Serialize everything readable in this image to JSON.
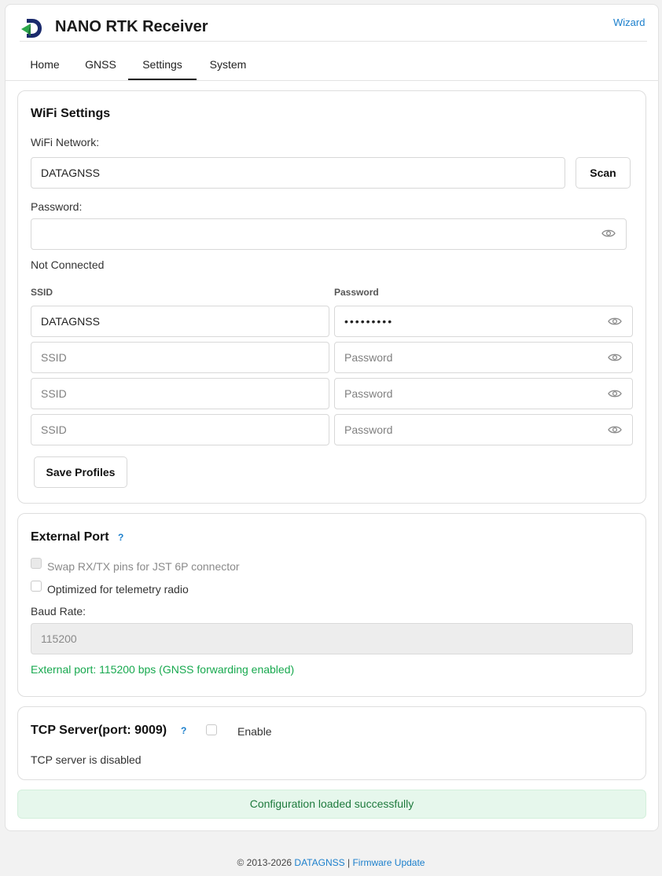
{
  "header": {
    "title": "NANO RTK Receiver",
    "wizard_link": "Wizard",
    "brand_colors": {
      "logo_dark": "#1a2a6c",
      "logo_green": "#2ba84a",
      "link": "#1b7fcc"
    }
  },
  "tabs": [
    {
      "label": "Home"
    },
    {
      "label": "GNSS"
    },
    {
      "label": "Settings",
      "active": true
    },
    {
      "label": "System"
    }
  ],
  "wifi": {
    "title": "WiFi Settings",
    "network_label": "WiFi Network:",
    "network_value": "DATAGNSS",
    "scan_label": "Scan",
    "password_label": "Password:",
    "password_value": "",
    "connection_status": "Not Connected",
    "ssid_header": "SSID",
    "password_header": "Password",
    "profiles": [
      {
        "ssid": "DATAGNSS",
        "password": "•••••••••",
        "ssid_placeholder": "SSID",
        "password_placeholder": "Password"
      },
      {
        "ssid": "",
        "password": "",
        "ssid_placeholder": "SSID",
        "password_placeholder": "Password"
      },
      {
        "ssid": "",
        "password": "",
        "ssid_placeholder": "SSID",
        "password_placeholder": "Password"
      },
      {
        "ssid": "",
        "password": "",
        "ssid_placeholder": "SSID",
        "password_placeholder": "Password"
      }
    ],
    "save_label": "Save Profiles"
  },
  "external_port": {
    "title": "External Port",
    "help": "?",
    "swap_label": "Swap RX/TX pins for JST 6P connector",
    "swap_checked": false,
    "swap_disabled": true,
    "telemetry_label": "Optimized for telemetry radio",
    "telemetry_checked": false,
    "baud_label": "Baud Rate:",
    "baud_value": "115200",
    "status": "External port: 115200 bps (GNSS forwarding enabled)",
    "status_color": "#18a94f"
  },
  "tcp": {
    "title": "TCP Server(port: 9009)",
    "help": "?",
    "enable_label": "Enable",
    "enabled": false,
    "status": "TCP server is disabled"
  },
  "toast": {
    "message": "Configuration loaded successfully"
  },
  "footer": {
    "copyright": "© 2013-2026",
    "company": "DATAGNSS",
    "separator": "|",
    "firmware_link": "Firmware Update"
  }
}
